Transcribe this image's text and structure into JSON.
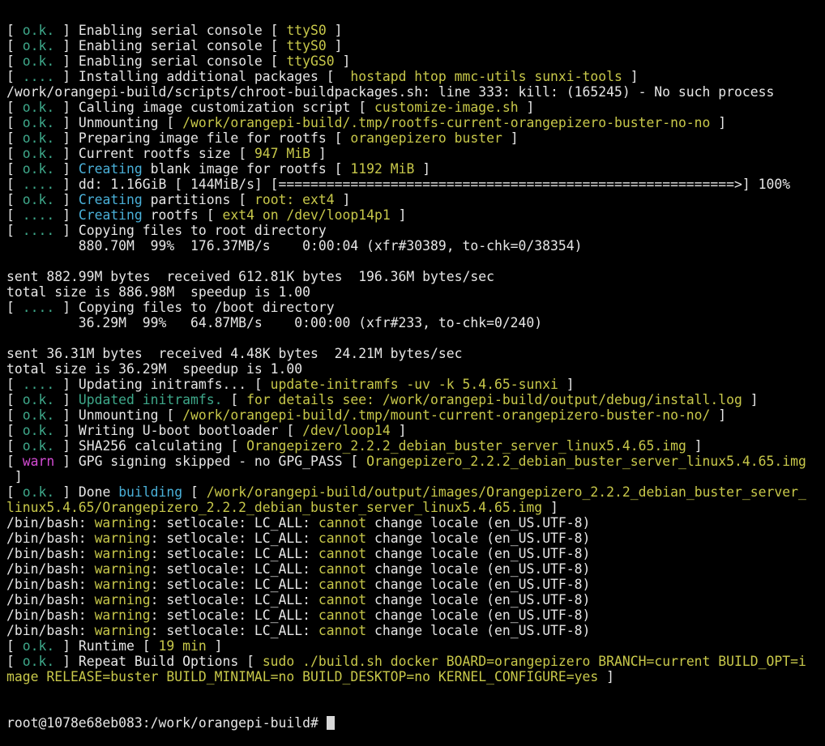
{
  "palette": {
    "w": "#e6e6e6",
    "g": "#3ea88a",
    "y": "#c8c84a",
    "c": "#4ab0d8",
    "m": "#d24bd2"
  },
  "terminal": {
    "lines": [
      [
        [
          "w",
          "[ "
        ],
        [
          "g",
          "o.k."
        ],
        [
          "w",
          " ] Enabling serial console [ "
        ],
        [
          "y",
          "ttyS0"
        ],
        [
          "w",
          " ]"
        ]
      ],
      [
        [
          "w",
          "[ "
        ],
        [
          "g",
          "o.k."
        ],
        [
          "w",
          " ] Enabling serial console [ "
        ],
        [
          "y",
          "ttyS0"
        ],
        [
          "w",
          " ]"
        ]
      ],
      [
        [
          "w",
          "[ "
        ],
        [
          "g",
          "o.k."
        ],
        [
          "w",
          " ] Enabling serial console [ "
        ],
        [
          "y",
          "ttyGS0"
        ],
        [
          "w",
          " ]"
        ]
      ],
      [
        [
          "w",
          "[ "
        ],
        [
          "g",
          "...."
        ],
        [
          "w",
          " ] Installing additional packages [  "
        ],
        [
          "y",
          "hostapd htop mmc-utils sunxi-tools"
        ],
        [
          "w",
          " ]"
        ]
      ],
      [
        [
          "w",
          "/work/orangepi-build/scripts/chroot-buildpackages.sh: line 333: kill: (165245) - No such process"
        ]
      ],
      [
        [
          "w",
          "[ "
        ],
        [
          "g",
          "o.k."
        ],
        [
          "w",
          " ] Calling image customization script [ "
        ],
        [
          "y",
          "customize-image.sh"
        ],
        [
          "w",
          " ]"
        ]
      ],
      [
        [
          "w",
          "[ "
        ],
        [
          "g",
          "o.k."
        ],
        [
          "w",
          " ] Unmounting [ "
        ],
        [
          "y",
          "/work/orangepi-build/.tmp/rootfs-current-orangepizero-buster-no-no"
        ],
        [
          "w",
          " ]"
        ]
      ],
      [
        [
          "w",
          "[ "
        ],
        [
          "g",
          "o.k."
        ],
        [
          "w",
          " ] Preparing image file for rootfs [ "
        ],
        [
          "y",
          "orangepizero buster"
        ],
        [
          "w",
          " ]"
        ]
      ],
      [
        [
          "w",
          "[ "
        ],
        [
          "g",
          "o.k."
        ],
        [
          "w",
          " ] Current rootfs size [ "
        ],
        [
          "y",
          "947 MiB"
        ],
        [
          "w",
          " ]"
        ]
      ],
      [
        [
          "w",
          "[ "
        ],
        [
          "g",
          "o.k."
        ],
        [
          "w",
          " ] "
        ],
        [
          "c",
          "Creating"
        ],
        [
          "w",
          " blank image for rootfs [ "
        ],
        [
          "y",
          "1192 MiB"
        ],
        [
          "w",
          " ]"
        ]
      ],
      [
        [
          "w",
          "[ "
        ],
        [
          "g",
          "...."
        ],
        [
          "w",
          " ] dd: 1.16GiB [ 144MiB/s] [=========================================================>] 100%"
        ]
      ],
      [
        [
          "w",
          "[ "
        ],
        [
          "g",
          "o.k."
        ],
        [
          "w",
          " ] "
        ],
        [
          "c",
          "Creating"
        ],
        [
          "w",
          " partitions [ "
        ],
        [
          "y",
          "root: ext4"
        ],
        [
          "w",
          " ]"
        ]
      ],
      [
        [
          "w",
          "[ "
        ],
        [
          "g",
          "...."
        ],
        [
          "w",
          " ] "
        ],
        [
          "c",
          "Creating"
        ],
        [
          "w",
          " rootfs [ "
        ],
        [
          "y",
          "ext4 on /dev/loop14p1"
        ],
        [
          "w",
          " ]"
        ]
      ],
      [
        [
          "w",
          "[ "
        ],
        [
          "g",
          "...."
        ],
        [
          "w",
          " ] Copying files to root directory"
        ]
      ],
      [
        [
          "w",
          "         880.70M  99%  176.37MB/s    0:00:04 (xfr#30389, to-chk=0/38354)"
        ]
      ],
      [
        [
          "w",
          ""
        ]
      ],
      [
        [
          "w",
          "sent 882.99M bytes  received 612.81K bytes  196.36M bytes/sec"
        ]
      ],
      [
        [
          "w",
          "total size is 886.98M  speedup is 1.00"
        ]
      ],
      [
        [
          "w",
          "[ "
        ],
        [
          "g",
          "...."
        ],
        [
          "w",
          " ] Copying files to /boot directory"
        ]
      ],
      [
        [
          "w",
          "         36.29M  99%   64.87MB/s    0:00:00 (xfr#233, to-chk=0/240)"
        ]
      ],
      [
        [
          "w",
          ""
        ]
      ],
      [
        [
          "w",
          "sent 36.31M bytes  received 4.48K bytes  24.21M bytes/sec"
        ]
      ],
      [
        [
          "w",
          "total size is 36.29M  speedup is 1.00"
        ]
      ],
      [
        [
          "w",
          "[ "
        ],
        [
          "g",
          "...."
        ],
        [
          "w",
          " ] Updating initramfs... [ "
        ],
        [
          "y",
          "update-initramfs -uv -k 5.4.65-sunxi"
        ],
        [
          "w",
          " ]"
        ]
      ],
      [
        [
          "w",
          "[ "
        ],
        [
          "g",
          "o.k."
        ],
        [
          "w",
          " ] "
        ],
        [
          "g",
          "Updated initramfs."
        ],
        [
          "w",
          " [ "
        ],
        [
          "y",
          "for details see: /work/orangepi-build/output/debug/install.log"
        ],
        [
          "w",
          " ]"
        ]
      ],
      [
        [
          "w",
          "[ "
        ],
        [
          "g",
          "o.k."
        ],
        [
          "w",
          " ] Unmounting [ "
        ],
        [
          "y",
          "/work/orangepi-build/.tmp/mount-current-orangepizero-buster-no-no/"
        ],
        [
          "w",
          " ]"
        ]
      ],
      [
        [
          "w",
          "[ "
        ],
        [
          "g",
          "o.k."
        ],
        [
          "w",
          " ] Writing U-boot bootloader [ "
        ],
        [
          "y",
          "/dev/loop14"
        ],
        [
          "w",
          " ]"
        ]
      ],
      [
        [
          "w",
          "[ "
        ],
        [
          "g",
          "o.k."
        ],
        [
          "w",
          " ] SHA256 calculating [ "
        ],
        [
          "y",
          "Orangepizero_2.2.2_debian_buster_server_linux5.4.65.img"
        ],
        [
          "w",
          " ]"
        ]
      ],
      [
        [
          "w",
          "[ "
        ],
        [
          "m",
          "warn"
        ],
        [
          "w",
          " ] GPG signing skipped - no GPG_PASS [ "
        ],
        [
          "y",
          "Orangepizero_2.2.2_debian_buster_server_linux5.4.65.img"
        ]
      ],
      [
        [
          "w",
          " ]"
        ]
      ],
      [
        [
          "w",
          "[ "
        ],
        [
          "g",
          "o.k."
        ],
        [
          "w",
          " ] Done "
        ],
        [
          "c",
          "building"
        ],
        [
          "w",
          " [ "
        ],
        [
          "y",
          "/work/orangepi-build/output/images/Orangepizero_2.2.2_debian_buster_server_"
        ]
      ],
      [
        [
          "y",
          "linux5.4.65/Orangepizero_2.2.2_debian_buster_server_linux5.4.65.img"
        ],
        [
          "w",
          " ]"
        ]
      ],
      [
        [
          "w",
          "/bin/bash: "
        ],
        [
          "y",
          "warning"
        ],
        [
          "w",
          ": setlocale: LC_ALL: "
        ],
        [
          "y",
          "cannot"
        ],
        [
          "w",
          " change locale (en_US.UTF-8)"
        ]
      ],
      [
        [
          "w",
          "/bin/bash: "
        ],
        [
          "y",
          "warning"
        ],
        [
          "w",
          ": setlocale: LC_ALL: "
        ],
        [
          "y",
          "cannot"
        ],
        [
          "w",
          " change locale (en_US.UTF-8)"
        ]
      ],
      [
        [
          "w",
          "/bin/bash: "
        ],
        [
          "y",
          "warning"
        ],
        [
          "w",
          ": setlocale: LC_ALL: "
        ],
        [
          "y",
          "cannot"
        ],
        [
          "w",
          " change locale (en_US.UTF-8)"
        ]
      ],
      [
        [
          "w",
          "/bin/bash: "
        ],
        [
          "y",
          "warning"
        ],
        [
          "w",
          ": setlocale: LC_ALL: "
        ],
        [
          "y",
          "cannot"
        ],
        [
          "w",
          " change locale (en_US.UTF-8)"
        ]
      ],
      [
        [
          "w",
          "/bin/bash: "
        ],
        [
          "y",
          "warning"
        ],
        [
          "w",
          ": setlocale: LC_ALL: "
        ],
        [
          "y",
          "cannot"
        ],
        [
          "w",
          " change locale (en_US.UTF-8)"
        ]
      ],
      [
        [
          "w",
          "/bin/bash: "
        ],
        [
          "y",
          "warning"
        ],
        [
          "w",
          ": setlocale: LC_ALL: "
        ],
        [
          "y",
          "cannot"
        ],
        [
          "w",
          " change locale (en_US.UTF-8)"
        ]
      ],
      [
        [
          "w",
          "/bin/bash: "
        ],
        [
          "y",
          "warning"
        ],
        [
          "w",
          ": setlocale: LC_ALL: "
        ],
        [
          "y",
          "cannot"
        ],
        [
          "w",
          " change locale (en_US.UTF-8)"
        ]
      ],
      [
        [
          "w",
          "/bin/bash: "
        ],
        [
          "y",
          "warning"
        ],
        [
          "w",
          ": setlocale: LC_ALL: "
        ],
        [
          "y",
          "cannot"
        ],
        [
          "w",
          " change locale (en_US.UTF-8)"
        ]
      ],
      [
        [
          "w",
          "[ "
        ],
        [
          "g",
          "o.k."
        ],
        [
          "w",
          " ] Runtime [ "
        ],
        [
          "y",
          "19 min"
        ],
        [
          "w",
          " ]"
        ]
      ],
      [
        [
          "w",
          "[ "
        ],
        [
          "g",
          "o.k."
        ],
        [
          "w",
          " ] Repeat Build Options [ "
        ],
        [
          "y",
          "sudo ./build.sh docker BOARD=orangepizero BRANCH=current BUILD_OPT=i"
        ]
      ],
      [
        [
          "y",
          "mage RELEASE=buster BUILD_MINIMAL=no BUILD_DESKTOP=no KERNEL_CONFIGURE=yes"
        ],
        [
          "w",
          " ]"
        ]
      ]
    ],
    "prompt": "root@1078e68eb083:/work/orangepi-build# "
  }
}
